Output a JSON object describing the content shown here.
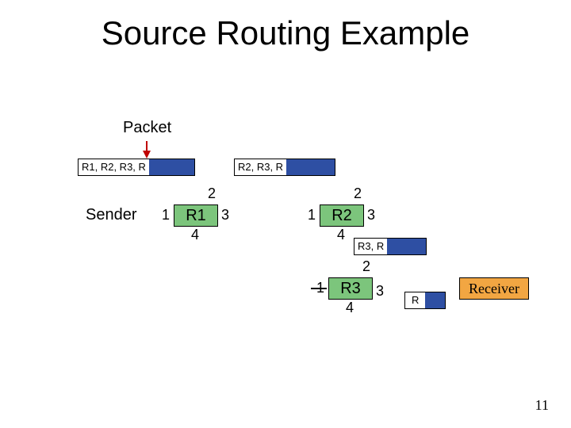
{
  "title": "Source Routing Example",
  "packet_label": "Packet",
  "sender_label": "Sender",
  "receiver_label": "Receiver",
  "slide_number": "11",
  "packets": {
    "p1": "R1, R2, R3, R",
    "p2": "R2, R3, R",
    "p3": "R3, R",
    "p4": "R"
  },
  "routers": {
    "r1": {
      "name": "R1",
      "ports": {
        "top": "2",
        "left": "1",
        "right": "3",
        "bottom": "4"
      }
    },
    "r2": {
      "name": "R2",
      "ports": {
        "top": "2",
        "left": "1",
        "right": "3",
        "bottom": "4"
      }
    },
    "r3": {
      "name": "R3",
      "ports": {
        "top": "2",
        "left": "1",
        "right": "3",
        "bottom": "4"
      }
    }
  }
}
